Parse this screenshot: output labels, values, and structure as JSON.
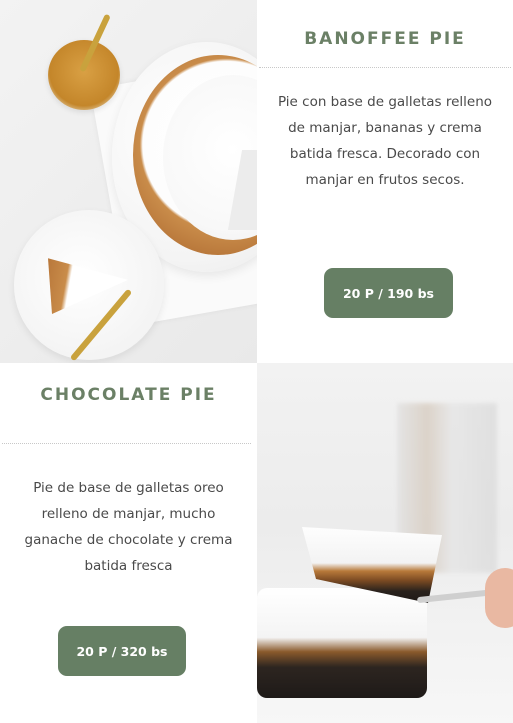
{
  "banoffee": {
    "title": "BANOFFEE PIE",
    "description": "Pie con base de galletas relleno de manjar, bananas y crema batida fresca. Decorado con manjar en frutos secos.",
    "price": "20 P / 190 bs",
    "image": "banoffee-pie-photo"
  },
  "chocolate": {
    "title": "CHOCOLATE PIE",
    "description": "Pie de base de galletas oreo relleno de manjar, mucho ganache de chocolate y crema batida fresca",
    "price": "20 P / 320 bs",
    "image": "chocolate-pie-photo"
  },
  "colors": {
    "accent": "#6b8066",
    "button": "#667f64",
    "text": "#4a4a4a"
  }
}
